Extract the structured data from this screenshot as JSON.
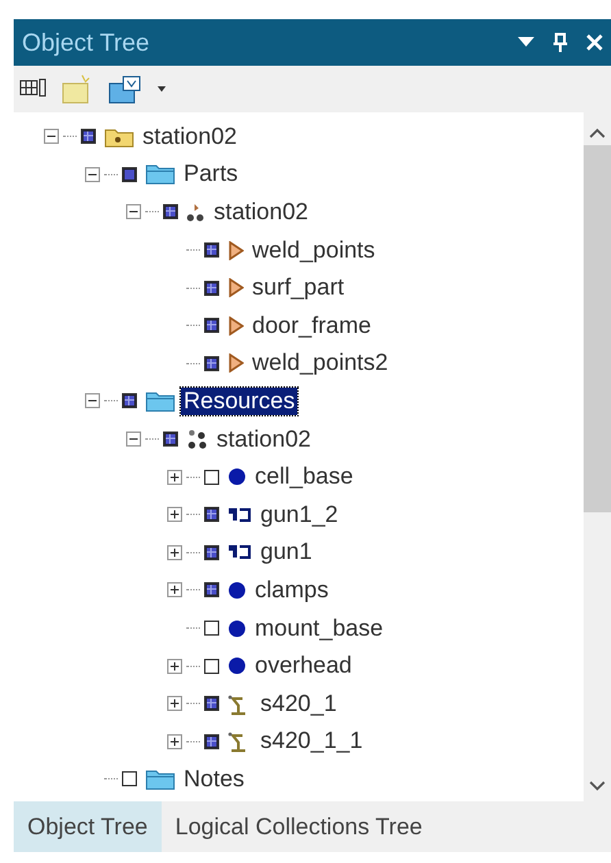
{
  "window": {
    "title": "Object Tree"
  },
  "tree": [
    {
      "label": "station02",
      "kind": "station",
      "checked": true,
      "partial": true,
      "expanded": true,
      "selected": false,
      "children": [
        {
          "label": "Parts",
          "kind": "folder",
          "checked": true,
          "partial": false,
          "expanded": true,
          "selected": false,
          "children": [
            {
              "label": "station02",
              "kind": "parts",
              "checked": true,
              "partial": true,
              "expanded": true,
              "selected": false,
              "children": [
                {
                  "label": "weld_points",
                  "kind": "part",
                  "checked": true,
                  "partial": true,
                  "selected": false
                },
                {
                  "label": "surf_part",
                  "kind": "part",
                  "checked": true,
                  "partial": true,
                  "selected": false
                },
                {
                  "label": "door_frame",
                  "kind": "part",
                  "checked": true,
                  "partial": true,
                  "selected": false
                },
                {
                  "label": "weld_points2",
                  "kind": "part",
                  "checked": true,
                  "partial": true,
                  "selected": false
                }
              ]
            }
          ]
        },
        {
          "label": "Resources",
          "kind": "folder",
          "checked": true,
          "partial": true,
          "expanded": true,
          "selected": true,
          "children": [
            {
              "label": "station02",
              "kind": "resources",
              "checked": true,
              "partial": true,
              "expanded": true,
              "selected": false,
              "children": [
                {
                  "label": "cell_base",
                  "kind": "ball",
                  "checked": false,
                  "partial": false,
                  "expanded": false,
                  "selected": false
                },
                {
                  "label": "gun1_2",
                  "kind": "gun",
                  "checked": true,
                  "partial": true,
                  "expanded": false,
                  "selected": false
                },
                {
                  "label": "gun1",
                  "kind": "gun",
                  "checked": true,
                  "partial": true,
                  "expanded": false,
                  "selected": false
                },
                {
                  "label": "clamps",
                  "kind": "ball",
                  "checked": true,
                  "partial": true,
                  "expanded": false,
                  "selected": false
                },
                {
                  "label": "mount_base",
                  "kind": "ball",
                  "checked": false,
                  "partial": false,
                  "selected": false
                },
                {
                  "label": "overhead",
                  "kind": "ball",
                  "checked": false,
                  "partial": false,
                  "expanded": false,
                  "selected": false
                },
                {
                  "label": "s420_1",
                  "kind": "robot",
                  "checked": true,
                  "partial": true,
                  "expanded": false,
                  "selected": false
                },
                {
                  "label": "s420_1_1",
                  "kind": "robot",
                  "checked": true,
                  "partial": true,
                  "expanded": false,
                  "selected": false
                }
              ]
            }
          ]
        },
        {
          "label": "Notes",
          "kind": "folder",
          "checked": false,
          "partial": false,
          "selected": false
        }
      ]
    }
  ],
  "tabs": [
    {
      "label": "Object Tree",
      "selected": true
    },
    {
      "label": "Logical Collections Tree",
      "selected": false
    }
  ]
}
